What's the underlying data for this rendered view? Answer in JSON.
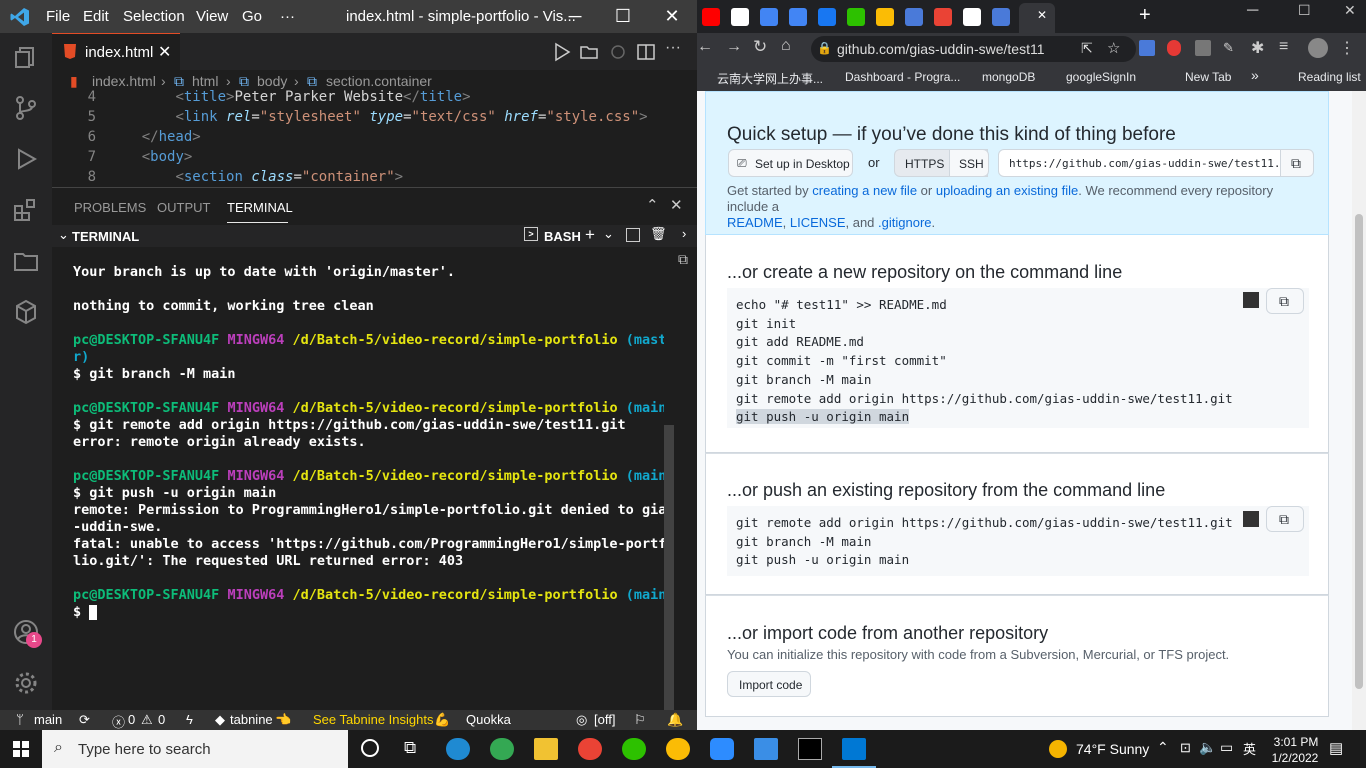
{
  "vscode": {
    "menu": [
      "File",
      "Edit",
      "Selection",
      "View",
      "Go",
      "···"
    ],
    "window_title": "index.html - simple-portfolio - Vis...",
    "tab_label": "index.html",
    "breadcrumb": [
      "index.html",
      "html",
      "body",
      "section.container"
    ],
    "editor_lines": [
      {
        "n": "4",
        "parts": [
          [
            "tg",
            "<"
          ],
          [
            "tn",
            "title"
          ],
          [
            "tg",
            ">"
          ],
          [
            "tx",
            "Peter Parker Website"
          ],
          [
            "tg",
            "</"
          ],
          [
            "tn",
            "title"
          ],
          [
            "tg",
            ">"
          ]
        ],
        "indent": "        "
      },
      {
        "n": "5",
        "parts": [
          [
            "tg",
            "<"
          ],
          [
            "tn",
            "link "
          ],
          [
            "at",
            "rel"
          ],
          [
            "tx",
            "="
          ],
          [
            "sv",
            "\"stylesheet\""
          ],
          [
            "tx",
            " "
          ],
          [
            "at",
            "type"
          ],
          [
            "tx",
            "="
          ],
          [
            "sv",
            "\"text/css\""
          ],
          [
            "tx",
            " "
          ],
          [
            "at",
            "href"
          ],
          [
            "tx",
            "="
          ],
          [
            "sv",
            "\"style.css\""
          ],
          [
            "tg",
            ">"
          ]
        ],
        "indent": "        "
      },
      {
        "n": "6",
        "parts": [
          [
            "tg",
            "</"
          ],
          [
            "tn",
            "head"
          ],
          [
            "tg",
            ">"
          ]
        ],
        "indent": "    "
      },
      {
        "n": "7",
        "parts": [
          [
            "tg",
            "<"
          ],
          [
            "tn",
            "body"
          ],
          [
            "tg",
            ">"
          ]
        ],
        "indent": "    "
      },
      {
        "n": "8",
        "parts": [
          [
            "tg",
            "<"
          ],
          [
            "tn",
            "section "
          ],
          [
            "at",
            "class"
          ],
          [
            "tx",
            "="
          ],
          [
            "sv",
            "\"container\""
          ],
          [
            "tg",
            ">"
          ]
        ],
        "indent": "        "
      }
    ],
    "panel_tabs": [
      "PROBLEMS",
      "OUTPUT",
      "TERMINAL"
    ],
    "terminal_title": "TERMINAL",
    "shell": "BASH",
    "terminal_lines": [
      [
        [
          "w",
          "Your branch is up to date with 'origin/master'."
        ]
      ],
      [],
      [
        [
          "w",
          "nothing to commit, working tree clean"
        ]
      ],
      [],
      [
        [
          "g",
          "pc@DESKTOP-SFANU4F "
        ],
        [
          "p",
          "MINGW64 "
        ],
        [
          "y",
          "/d/Batch-5/video-record/simple-portfolio "
        ],
        [
          "c",
          "(maste"
        ]
      ],
      [
        [
          "c",
          "r)"
        ]
      ],
      [
        [
          "w",
          "$ git branch -M main"
        ]
      ],
      [],
      [
        [
          "g",
          "pc@DESKTOP-SFANU4F "
        ],
        [
          "p",
          "MINGW64 "
        ],
        [
          "y",
          "/d/Batch-5/video-record/simple-portfolio "
        ],
        [
          "c",
          "(main)"
        ]
      ],
      [
        [
          "w",
          "$ git remote add origin https://github.com/gias-uddin-swe/test11.git"
        ]
      ],
      [
        [
          "w",
          "error: remote origin already exists."
        ]
      ],
      [],
      [
        [
          "g",
          "pc@DESKTOP-SFANU4F "
        ],
        [
          "p",
          "MINGW64 "
        ],
        [
          "y",
          "/d/Batch-5/video-record/simple-portfolio "
        ],
        [
          "c",
          "(main)"
        ]
      ],
      [
        [
          "w",
          "$ git push -u origin main"
        ]
      ],
      [
        [
          "w",
          "remote: Permission to ProgrammingHero1/simple-portfolio.git denied to gias"
        ]
      ],
      [
        [
          "w",
          "-uddin-swe."
        ]
      ],
      [
        [
          "w",
          "fatal: unable to access 'https://github.com/ProgrammingHero1/simple-portfo"
        ]
      ],
      [
        [
          "w",
          "lio.git/': The requested URL returned error: 403"
        ]
      ],
      [],
      [
        [
          "g",
          "pc@DESKTOP-SFANU4F "
        ],
        [
          "p",
          "MINGW64 "
        ],
        [
          "y",
          "/d/Batch-5/video-record/simple-portfolio "
        ],
        [
          "c",
          "(main)"
        ]
      ],
      [
        [
          "w",
          "$ "
        ]
      ]
    ],
    "status": {
      "branch": "main",
      "errors": "0",
      "warnings": "0",
      "tabnine": "tabnine",
      "tabnine_insights": "See Tabnine Insights",
      "quokka": "Quokka",
      "off": "[off]",
      "account_badge": "1"
    }
  },
  "browser": {
    "url": "github.com/gias-uddin-swe/test11",
    "bookmarks": [
      "云南大学网上办事...",
      "Dashboard - Progra...",
      "mongoDB",
      "googleSignIn",
      "New Tab",
      "»",
      "Reading list"
    ],
    "quick_setup": {
      "title": "Quick setup — if you’ve done this kind of thing before",
      "desktop_btn": "Set up in Desktop",
      "or": "or",
      "https": "HTTPS",
      "ssh": "SSH",
      "clone_url": "https://github.com/gias-uddin-swe/test11.gi",
      "text_1": "Get started by ",
      "link_new": "creating a new file",
      "text_2": " or ",
      "link_upload": "uploading an existing file",
      "text_3": ". We recommend every repository include a",
      "link_readme": "README",
      "sep1": ", ",
      "link_license": "LICENSE",
      "sep2": ", and ",
      "link_gitignore": ".gitignore",
      "end": "."
    },
    "create_new": {
      "title": "...or create a new repository on the command line",
      "lines": [
        "echo \"# test11\" >> README.md",
        "git init",
        "git add README.md",
        "git commit -m \"first commit\"",
        "git branch -M main",
        "git remote add origin https://github.com/gias-uddin-swe/test11.git",
        "git push -u origin main"
      ]
    },
    "push_existing": {
      "title": "...or push an existing repository from the command line",
      "lines": [
        "git remote add origin https://github.com/gias-uddin-swe/test11.git",
        "git branch -M main",
        "git push -u origin main"
      ]
    },
    "import": {
      "title": "...or import code from another repository",
      "desc": "You can initialize this repository with code from a Subversion, Mercurial, or TFS project.",
      "button": "Import code"
    }
  },
  "taskbar": {
    "search_placeholder": "Type here to search",
    "weather": "74°F  Sunny",
    "time": "3:01 PM",
    "date": "1/2/2022"
  }
}
